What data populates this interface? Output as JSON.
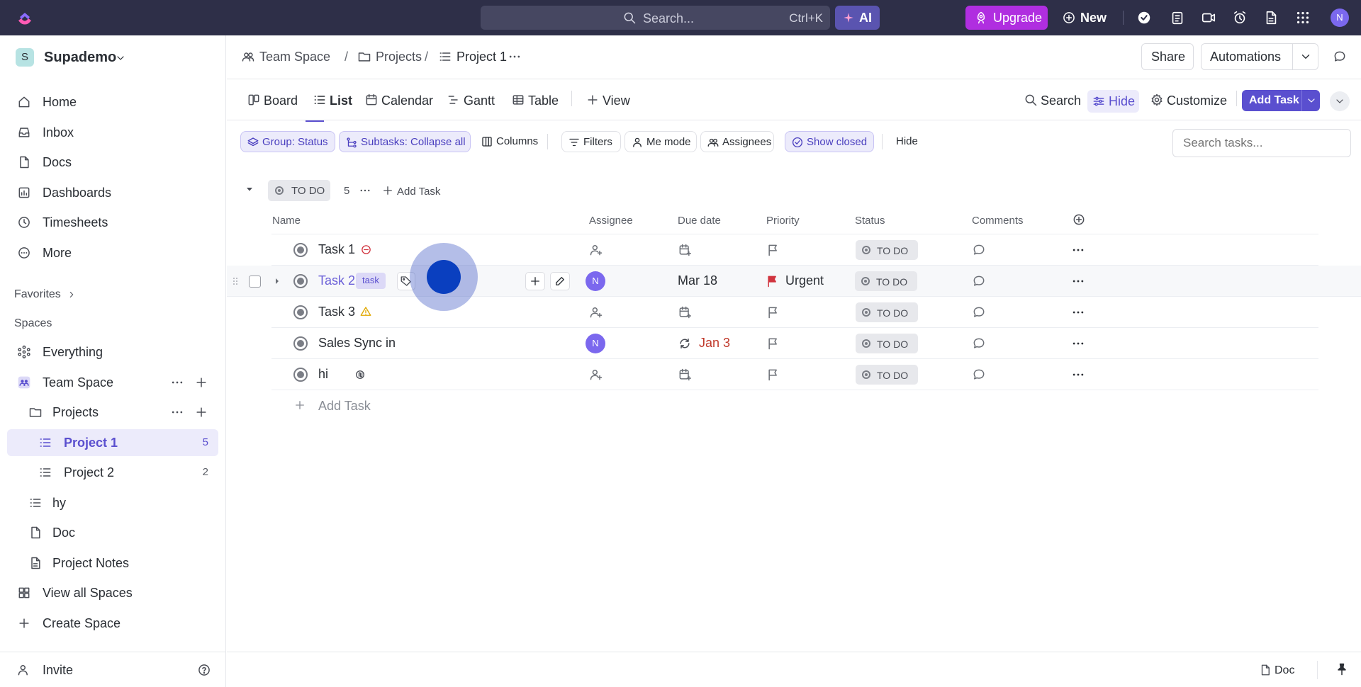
{
  "topbar": {
    "search_placeholder": "Search...",
    "search_shortcut": "Ctrl+K",
    "ai_label": "AI",
    "upgrade_label": "Upgrade",
    "new_label": "New",
    "avatar_initial": "N"
  },
  "sidebar": {
    "workspace_initial": "S",
    "workspace_name": "Supademo",
    "nav": [
      "Home",
      "Inbox",
      "Docs",
      "Dashboards",
      "Timesheets",
      "More"
    ],
    "favorites_label": "Favorites",
    "spaces_label": "Spaces",
    "everything_label": "Everything",
    "team_space_label": "Team Space",
    "projects_label": "Projects",
    "project1_label": "Project 1",
    "project1_count": "5",
    "project2_label": "Project 2",
    "project2_count": "2",
    "hy_label": "hy",
    "doc_label": "Doc",
    "project_notes_label": "Project Notes",
    "view_all_spaces_label": "View all Spaces",
    "create_space_label": "Create Space",
    "invite_label": "Invite"
  },
  "breadcrumb": {
    "team_space": "Team Space",
    "projects": "Projects",
    "project": "Project 1",
    "separator": "/"
  },
  "header": {
    "share_label": "Share",
    "automations_label": "Automations"
  },
  "views": {
    "tabs": [
      "Board",
      "List",
      "Calendar",
      "Gantt",
      "Table"
    ],
    "add_view_label": "View",
    "search_label": "Search",
    "hide_label": "Hide",
    "customize_label": "Customize",
    "add_task_label": "Add Task"
  },
  "filters": {
    "group": "Group: Status",
    "subtasks": "Subtasks: Collapse all",
    "columns": "Columns",
    "filters": "Filters",
    "me_mode": "Me mode",
    "assignees": "Assignees",
    "show_closed": "Show closed",
    "hide": "Hide",
    "search_placeholder": "Search tasks..."
  },
  "group": {
    "status": "TO DO",
    "count": "5",
    "add_task_label": "Add Task"
  },
  "columns": [
    "Name",
    "Assignee",
    "Due date",
    "Priority",
    "Status",
    "Comments"
  ],
  "tasks": [
    {
      "name": "Task 1",
      "status": "TO DO"
    },
    {
      "name": "Task 2",
      "tag": "task",
      "assignee": "N",
      "due": "Mar 18",
      "priority": "Urgent",
      "status": "TO DO"
    },
    {
      "name": "Task 3",
      "status": "TO DO"
    },
    {
      "name": "Sales Sync in",
      "assignee": "N",
      "due": "Jan 3",
      "status": "TO DO"
    },
    {
      "name": "hi",
      "status": "TO DO"
    }
  ],
  "add_task_row_label": "Add Task",
  "bottom": {
    "doc_label": "Doc"
  },
  "colors": {
    "accent": "#5a4fcf",
    "topbar": "#2e2f48",
    "upgrade": "#b02ee0",
    "urgent": "#d1343f",
    "due_red": "#c0392b"
  }
}
